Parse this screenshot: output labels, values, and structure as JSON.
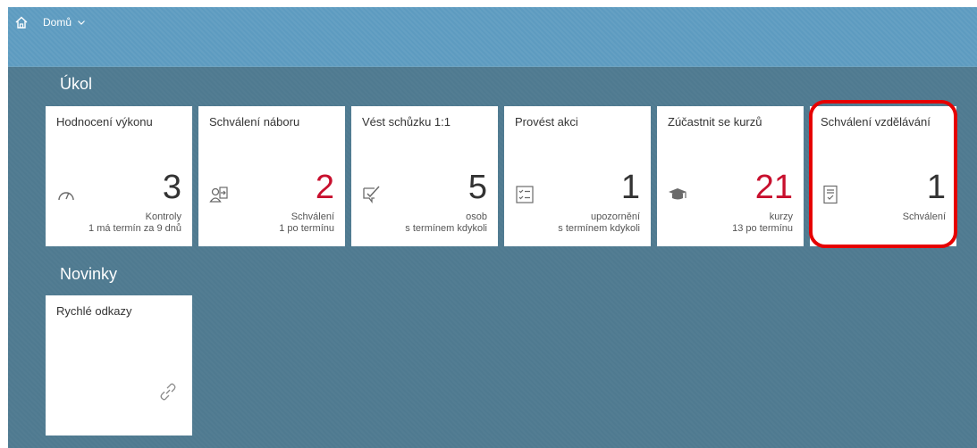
{
  "header": {
    "nav_label": "Domů"
  },
  "sections": {
    "tasks_title": "Úkol",
    "news_title": "Novinky"
  },
  "tiles": [
    {
      "title": "Hodnocení výkonu",
      "number": "3",
      "unit": "Kontroly",
      "footer": "1 má termín za 9 dnů",
      "icon": "gauge-icon",
      "number_color": "#333333"
    },
    {
      "title": "Schválení náboru",
      "number": "2",
      "unit": "Schválení",
      "footer": "1 po termínu",
      "icon": "person-arrow-icon",
      "number_color": "#c8102e"
    },
    {
      "title": "Vést schůzku 1:1",
      "number": "5",
      "unit": "osob",
      "footer": "s termínem kdykoli",
      "icon": "checkmark-chat-icon",
      "number_color": "#333333"
    },
    {
      "title": "Provést akci",
      "number": "1",
      "unit": "upozornění",
      "footer": "s termínem kdykoli",
      "icon": "checklist-icon",
      "number_color": "#333333"
    },
    {
      "title": "Zúčastnit se kurzů",
      "number": "21",
      "unit": "kurzy",
      "footer": "13 po termínu",
      "icon": "graduation-cap-icon",
      "number_color": "#c8102e"
    },
    {
      "title": "Schválení vzdělávání",
      "number": "1",
      "unit": "Schválení",
      "footer": "",
      "icon": "document-check-icon",
      "number_color": "#333333"
    }
  ],
  "news": {
    "title": "Rychlé odkazy",
    "icon": "link-icon"
  },
  "colors": {
    "background": "#4f7a90",
    "header": "#5d9bc0",
    "highlight": "#e60000"
  }
}
